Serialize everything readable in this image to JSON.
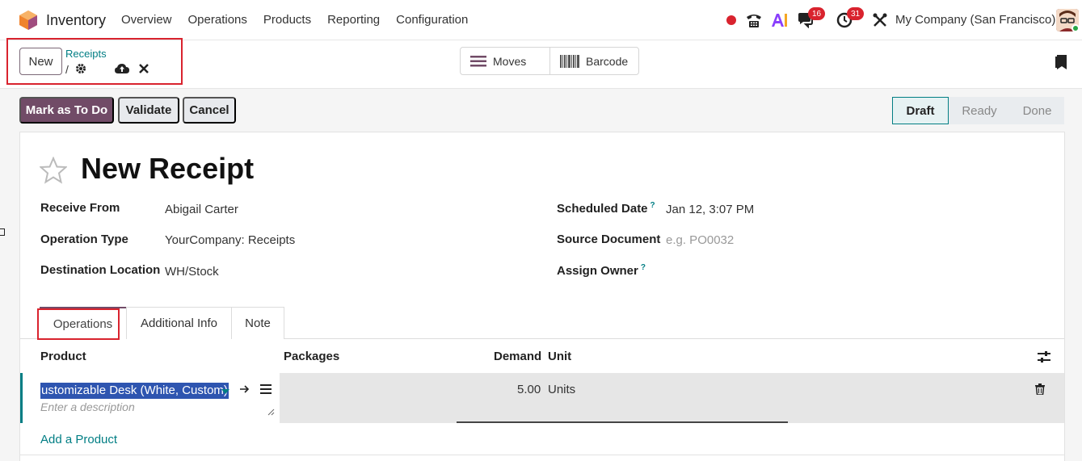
{
  "navbar": {
    "app_name": "Inventory",
    "menu": [
      "Overview",
      "Operations",
      "Products",
      "Reporting",
      "Configuration"
    ],
    "chat_badge": "16",
    "activity_badge": "31",
    "company": "My Company (San Francisco)"
  },
  "control": {
    "new_label": "New",
    "breadcrumb": "Receipts",
    "slash": "/",
    "views": {
      "moves": "Moves",
      "barcode": "Barcode"
    }
  },
  "status": {
    "mark_todo": "Mark as To Do",
    "validate": "Validate",
    "cancel": "Cancel",
    "stages": [
      "Draft",
      "Ready",
      "Done"
    ]
  },
  "form": {
    "title": "New Receipt",
    "receive_from_label": "Receive From",
    "receive_from": "Abigail Carter",
    "operation_type_label": "Operation Type",
    "operation_type": "YourCompany: Receipts",
    "destination_label": "Destination Location",
    "destination": "WH/Stock",
    "scheduled_label": "Scheduled Date",
    "scheduled": "Jan 12, 3:07 PM",
    "source_label": "Source Document",
    "source_placeholder": "e.g. PO0032",
    "owner_label": "Assign Owner",
    "help_mark": "?"
  },
  "tabs": [
    "Operations",
    "Additional Info",
    "Note"
  ],
  "table": {
    "headers": {
      "product": "Product",
      "packages": "Packages",
      "demand": "Demand",
      "unit": "Unit"
    },
    "row": {
      "product": "ustomizable Desk (White, Custom)",
      "description_placeholder": "Enter a description",
      "demand": "5.00",
      "unit": "Units"
    },
    "add_product": "Add a Product"
  },
  "colors": {
    "primary": "#714b67",
    "link": "#017e84",
    "highlight": "#d9232e"
  }
}
